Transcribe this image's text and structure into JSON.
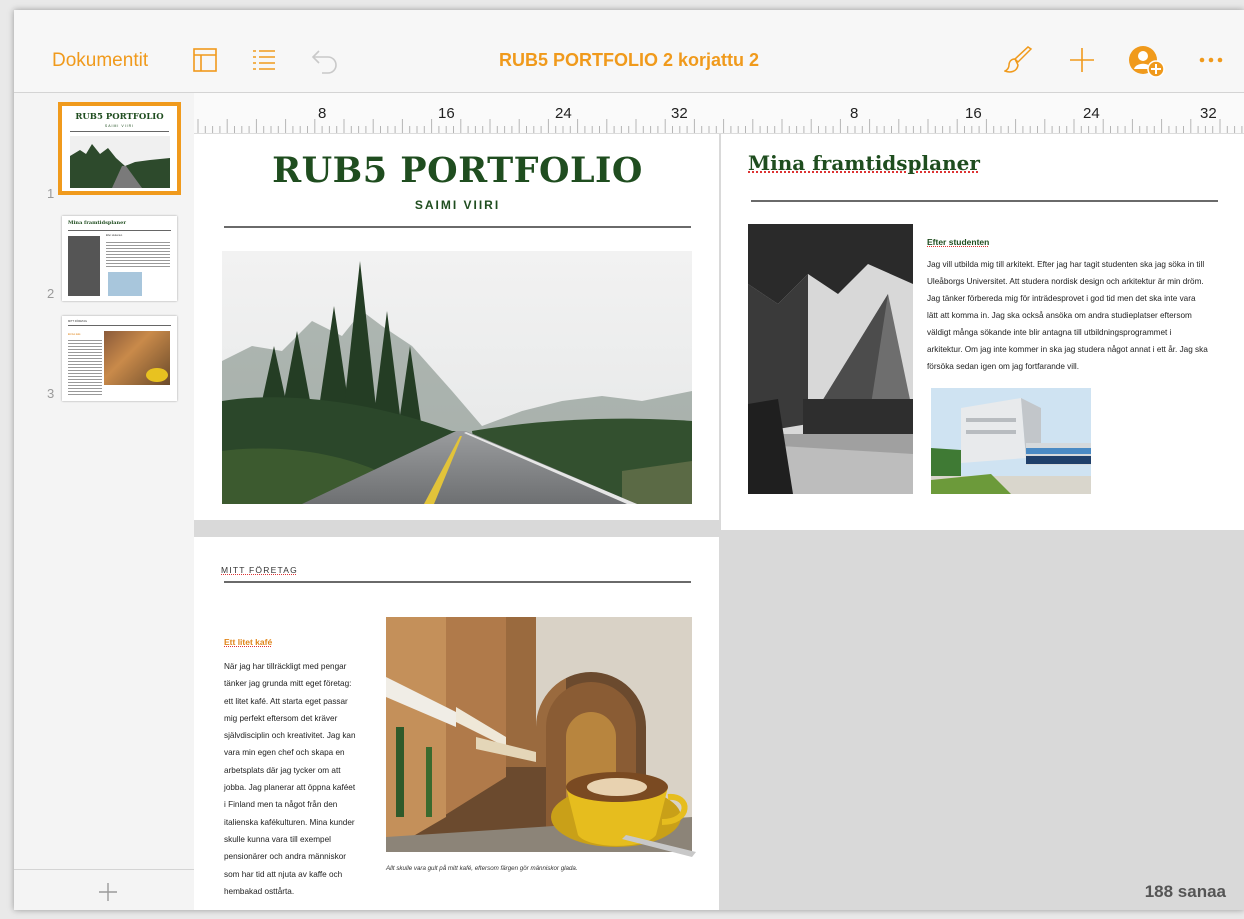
{
  "toolbar": {
    "documents_label": "Dokumentit",
    "title": "RUB5 PORTFOLIO 2 korjattu 2",
    "icons": [
      "sidebar-toggle-icon",
      "list-icon",
      "undo-icon",
      "brush-icon",
      "plus-icon",
      "add-collaborator-icon",
      "more-icon"
    ]
  },
  "sidebar": {
    "thumbnails": [
      {
        "number": "1",
        "title": "RUB5 PORTFOLIO",
        "subtitle": "SAIMI VIIRI"
      },
      {
        "number": "2",
        "title": "Mina framtidsplaner",
        "subtitle": "Efter studenten"
      },
      {
        "number": "3",
        "title": "MITT FÖRETAG",
        "subtitle": "Ett litet kafé"
      }
    ]
  },
  "ruler": {
    "labels": [
      "8",
      "16",
      "24",
      "32",
      "8",
      "16",
      "24",
      "32"
    ]
  },
  "page1": {
    "title": "RUB5 PORTFOLIO",
    "author": "SAIMI VIIRI"
  },
  "page2": {
    "title": "Mina framtidsplaner",
    "section": "Efter studenten",
    "lines": [
      "Jag vill utbilda mig till arkitekt. Efter jag har tagit studenten ska jag söka in till",
      "Uleåborgs Universitet. Att studera nordisk design och arkitektur är min dröm.",
      "Jag tänker förbereda mig för inträdesprovet i god tid men det ska inte vara",
      "lätt att komma in. Jag ska också ansöka om andra studieplatser eftersom",
      "väldigt många sökande inte blir antagna till utbildningsprogrammet i",
      "arkitektur. Om jag inte kommer in ska jag studera något annat i ett år. Jag ska",
      "försöka sedan igen om jag fortfarande vill."
    ]
  },
  "page3": {
    "heading": "MITT FÖRETAG",
    "section": "Ett litet kafé",
    "lines": [
      "När jag har tillräckligt med pengar",
      "tänker jag grunda mitt eget företag:",
      "ett litet kafé. Att starta eget passar",
      "mig perfekt eftersom det kräver",
      "självdisciplin och kreativitet. Jag kan",
      "vara min egen chef och skapa en",
      "arbetsplats där jag tycker om att",
      "jobba. Jag planerar att öppna kaféet",
      "i Finland men ta något från den",
      "italienska kafékulturen. Mina kunder",
      "skulle kunna vara till exempel",
      "pensionärer och andra människor",
      "som har tid att njuta av kaffe och",
      "hembakad osttårta."
    ],
    "caption": "Allt skulle vara gult på mitt kafé, eftersom färgen gör människor glada."
  },
  "word_count": "188 sanaa",
  "colors": {
    "accent": "#f09a1c",
    "title_green": "#1f4d1f",
    "section_orange": "#e0851a"
  }
}
